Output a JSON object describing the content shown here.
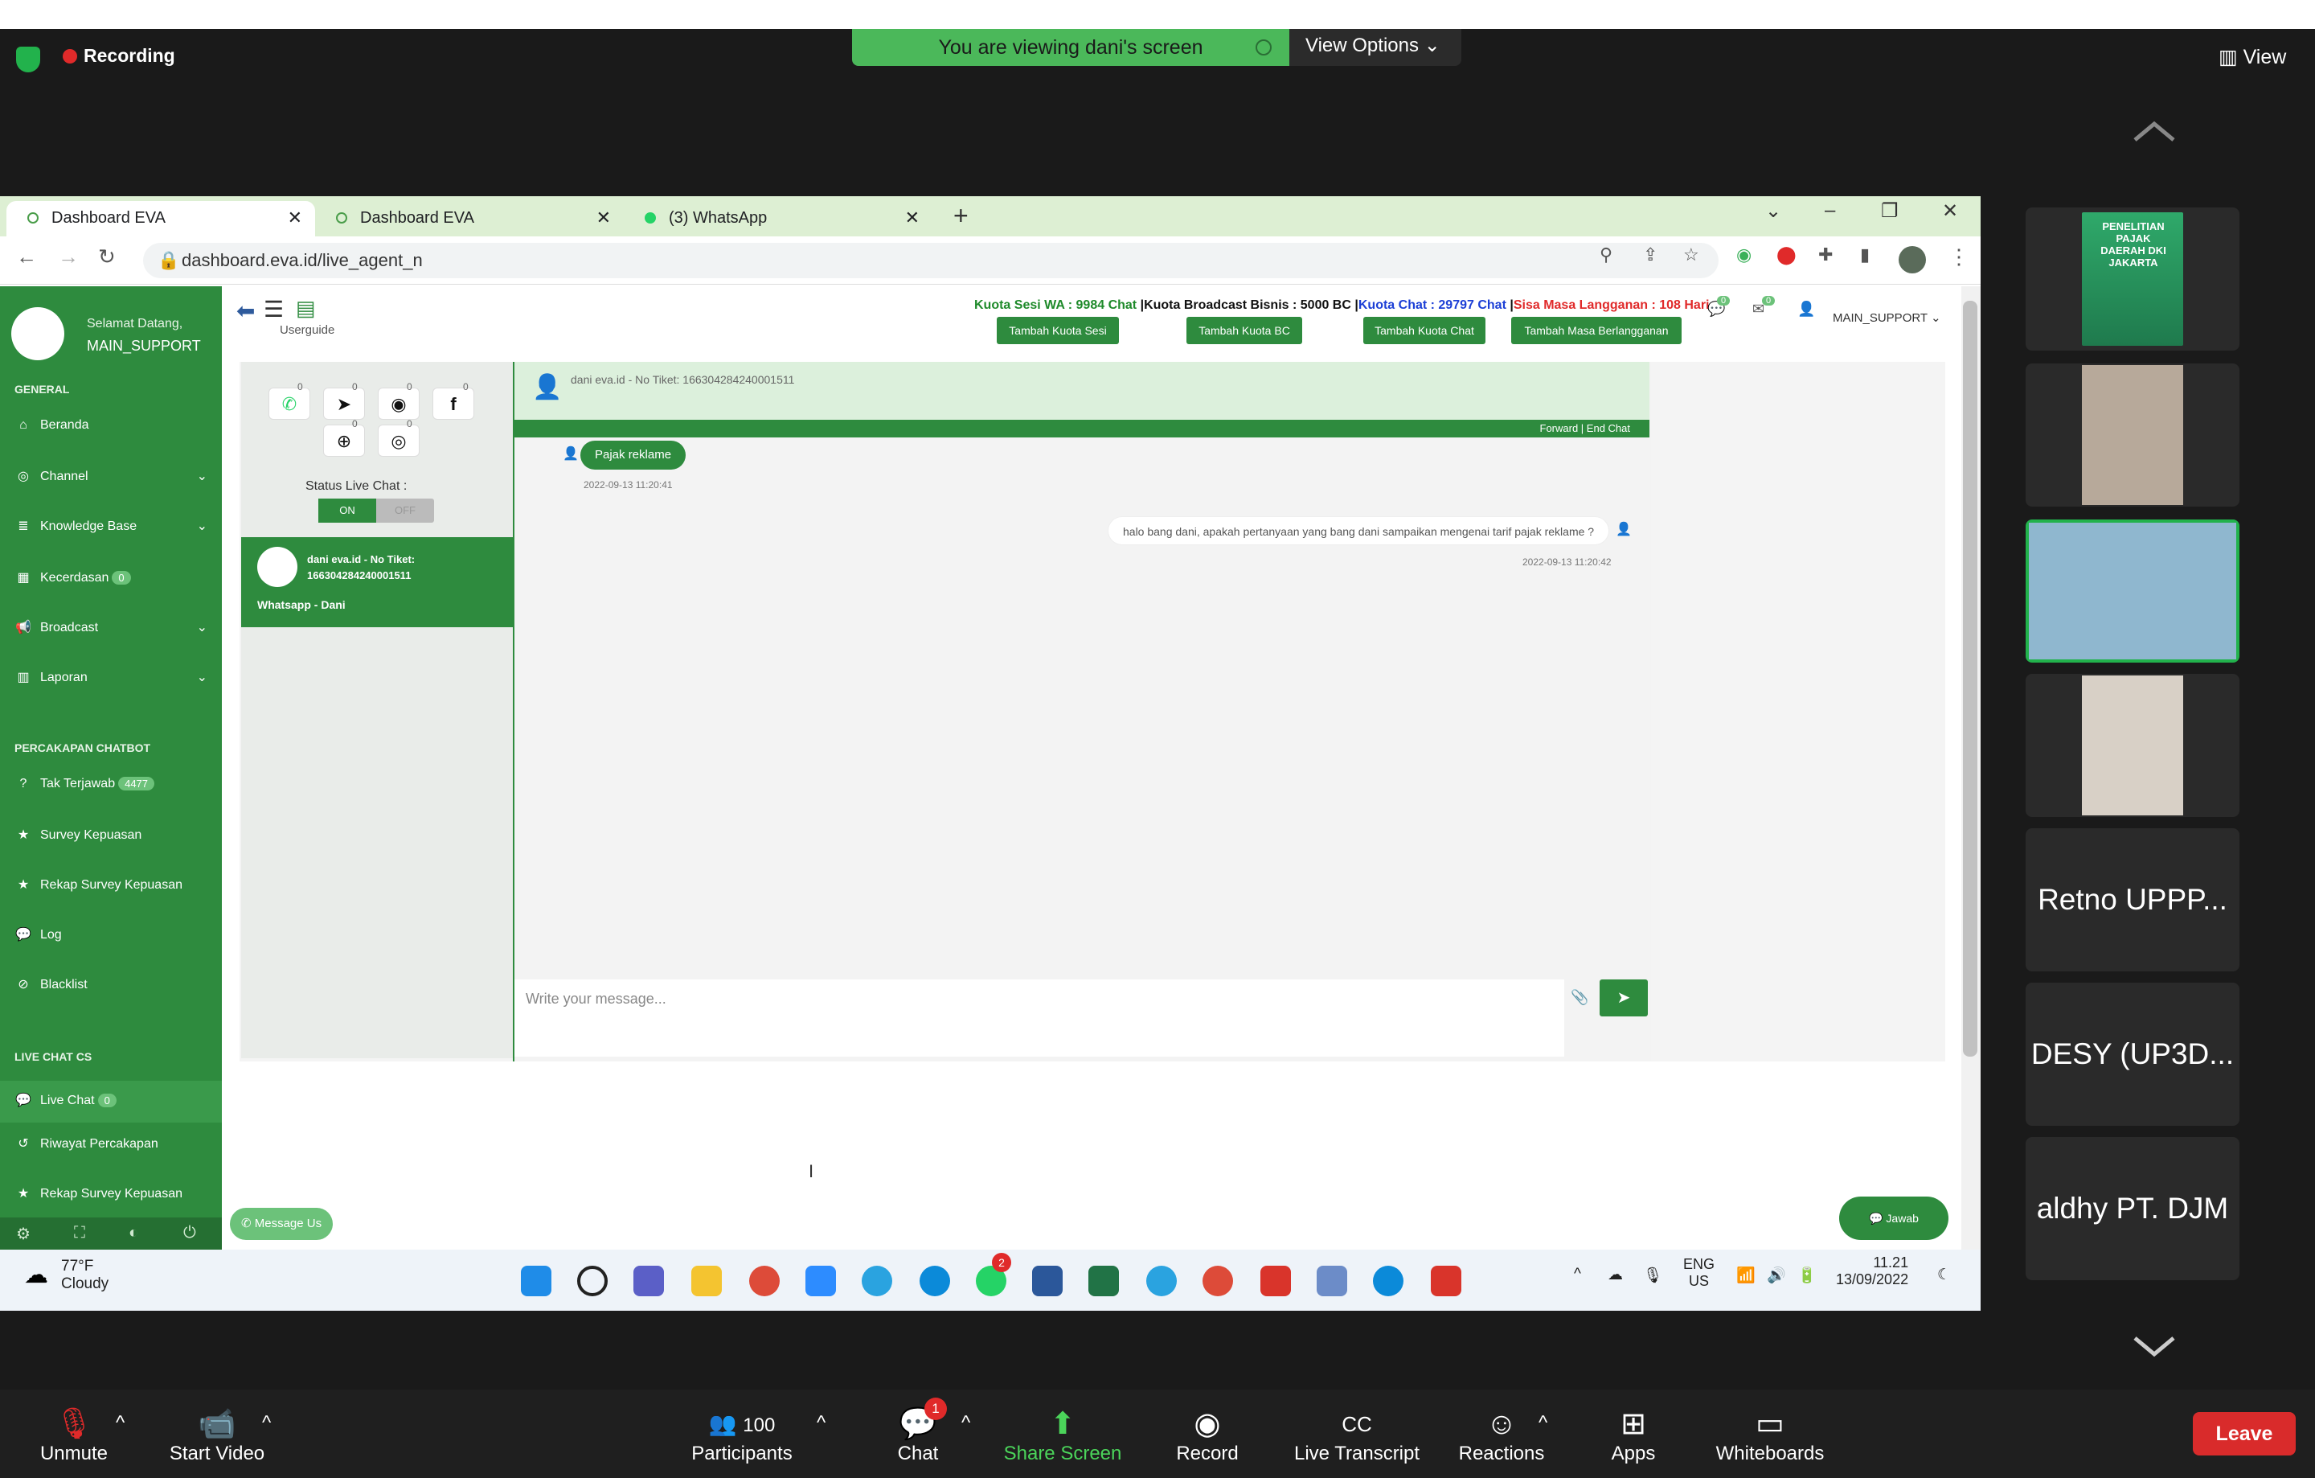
{
  "zoom": {
    "recording_label": "Recording",
    "viewing_banner": "You are viewing dani's screen",
    "view_options": "View Options",
    "view_right": "View",
    "participants_count": "100",
    "chat_badge": "1",
    "toolbar": {
      "unmute": "Unmute",
      "start_video": "Start Video",
      "participants": "Participants",
      "chat": "Chat",
      "share_screen": "Share Screen",
      "record": "Record",
      "live_transcript": "Live Transcript",
      "reactions": "Reactions",
      "apps": "Apps",
      "whiteboards": "Whiteboards",
      "leave": "Leave"
    },
    "tiles": [
      "Retno UPPP...",
      "DESY (UP3D...",
      "aldhy PT. DJM"
    ],
    "poster_text": "PENELITIAN PAJAK DAERAH DKI JAKARTA"
  },
  "browser": {
    "tabs": [
      {
        "title": "Dashboard EVA"
      },
      {
        "title": "Dashboard EVA"
      },
      {
        "title": "(3) WhatsApp"
      }
    ],
    "url": "dashboard.eva.id/live_agent_n"
  },
  "app": {
    "greeting": "Selamat Datang,",
    "username": "MAIN_SUPPORT",
    "userguide": "Userguide",
    "sections": {
      "general": "GENERAL",
      "chatbot": "PERCAKAPAN CHATBOT",
      "livechat": "LIVE CHAT CS"
    },
    "menu_general": [
      {
        "label": "Beranda"
      },
      {
        "label": "Channel"
      },
      {
        "label": "Knowledge Base"
      },
      {
        "label": "Kecerdasan",
        "badge": "0"
      },
      {
        "label": "Broadcast"
      },
      {
        "label": "Laporan"
      }
    ],
    "menu_chatbot": [
      {
        "label": "Tak Terjawab",
        "badge": "4477"
      },
      {
        "label": "Survey Kepuasan"
      },
      {
        "label": "Rekap Survey Kepuasan"
      },
      {
        "label": "Log"
      },
      {
        "label": "Blacklist"
      }
    ],
    "menu_livechat": [
      {
        "label": "Live Chat",
        "badge": "0"
      },
      {
        "label": "Riwayat Percakapan"
      },
      {
        "label": "Rekap Survey Kepuasan"
      }
    ],
    "quota": {
      "sesi": "Kuota Sesi WA : 9984 Chat",
      "bc": "Kuota Broadcast Bisnis : 5000 BC",
      "chat": "Kuota Chat : 29797 Chat",
      "masa": "Sisa Masa Langganan : 108 Hari"
    },
    "buttons": {
      "sesi": "Tambah Kuota Sesi",
      "bc": "Tambah Kuota BC",
      "chat": "Tambah Kuota Chat",
      "masa": "Tambah Masa Berlangganan"
    },
    "header_user": "MAIN_SUPPORT",
    "header_badges": [
      "0",
      "0"
    ],
    "channel_counts": [
      "0",
      "0",
      "0",
      "0",
      "0",
      "0"
    ],
    "status_label": "Status Live Chat :",
    "toggle_on": "ON",
    "toggle_off": "OFF",
    "conversation": {
      "name": "dani eva.id - No Tiket: 166304284240001511",
      "source": "Whatsapp - Dani"
    },
    "chat": {
      "header": "dani eva.id - No Tiket: 166304284240001511",
      "actions": "Forward | End Chat",
      "msg_in": "Pajak reklame",
      "msg_in_time": "2022-09-13 11:20:41",
      "msg_out": "halo bang dani, apakah pertanyaan yang bang dani sampaikan mengenai tarif pajak reklame ?",
      "msg_out_time": "2022-09-13 11:20:42",
      "input_placeholder": "Write your message..."
    },
    "message_us": "Message Us",
    "jawab": "Jawab"
  },
  "taskbar": {
    "temp": "77°F",
    "weather": "Cloudy",
    "lang1": "ENG",
    "lang2": "US",
    "time": "11.21",
    "date": "13/09/2022",
    "wa_badge": "2"
  }
}
